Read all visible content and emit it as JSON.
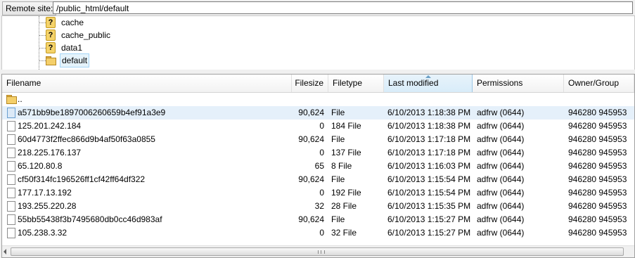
{
  "remote": {
    "label": "Remote site:",
    "path": "/public_html/default"
  },
  "tree": {
    "items": [
      {
        "label": "cache",
        "icon": "unknown-folder-icon"
      },
      {
        "label": "cache_public",
        "icon": "unknown-folder-icon"
      },
      {
        "label": "data1",
        "icon": "unknown-folder-icon"
      },
      {
        "label": "default",
        "icon": "folder-icon",
        "selected": true
      }
    ]
  },
  "columns": {
    "filename": "Filename",
    "filesize": "Filesize",
    "filetype": "Filetype",
    "last_modified": "Last modified",
    "permissions": "Permissions",
    "owner_group": "Owner/Group"
  },
  "parent_entry": "..",
  "files": [
    {
      "name": "a571bb9be1897006260659b4ef91a3e9",
      "size": "90,624",
      "type": "File",
      "modified": "6/10/2013 1:18:38 PM",
      "perm": "adfrw (0644)",
      "owner": "946280 945953",
      "selected": true
    },
    {
      "name": "125.201.242.184",
      "size": "0",
      "type": "184 File",
      "modified": "6/10/2013 1:18:38 PM",
      "perm": "adfrw (0644)",
      "owner": "946280 945953"
    },
    {
      "name": "60d4773f2ffec866d9b4af50f63a0855",
      "size": "90,624",
      "type": "File",
      "modified": "6/10/2013 1:17:18 PM",
      "perm": "adfrw (0644)",
      "owner": "946280 945953"
    },
    {
      "name": "218.225.176.137",
      "size": "0",
      "type": "137 File",
      "modified": "6/10/2013 1:17:18 PM",
      "perm": "adfrw (0644)",
      "owner": "946280 945953"
    },
    {
      "name": "65.120.80.8",
      "size": "65",
      "type": "8 File",
      "modified": "6/10/2013 1:16:03 PM",
      "perm": "adfrw (0644)",
      "owner": "946280 945953"
    },
    {
      "name": "cf50f314fc196526ff1cf42ff64df322",
      "size": "90,624",
      "type": "File",
      "modified": "6/10/2013 1:15:54 PM",
      "perm": "adfrw (0644)",
      "owner": "946280 945953"
    },
    {
      "name": "177.17.13.192",
      "size": "0",
      "type": "192 File",
      "modified": "6/10/2013 1:15:54 PM",
      "perm": "adfrw (0644)",
      "owner": "946280 945953"
    },
    {
      "name": "193.255.220.28",
      "size": "32",
      "type": "28 File",
      "modified": "6/10/2013 1:15:35 PM",
      "perm": "adfrw (0644)",
      "owner": "946280 945953"
    },
    {
      "name": "55bb55438f3b7495680db0cc46d983af",
      "size": "90,624",
      "type": "File",
      "modified": "6/10/2013 1:15:27 PM",
      "perm": "adfrw (0644)",
      "owner": "946280 945953"
    },
    {
      "name": "105.238.3.32",
      "size": "0",
      "type": "32 File",
      "modified": "6/10/2013 1:15:27 PM",
      "perm": "adfrw (0644)",
      "owner": "946280 945953"
    }
  ],
  "colors": {
    "selection": "#e5f0fa",
    "header_sorted": "#d8ecf9"
  }
}
